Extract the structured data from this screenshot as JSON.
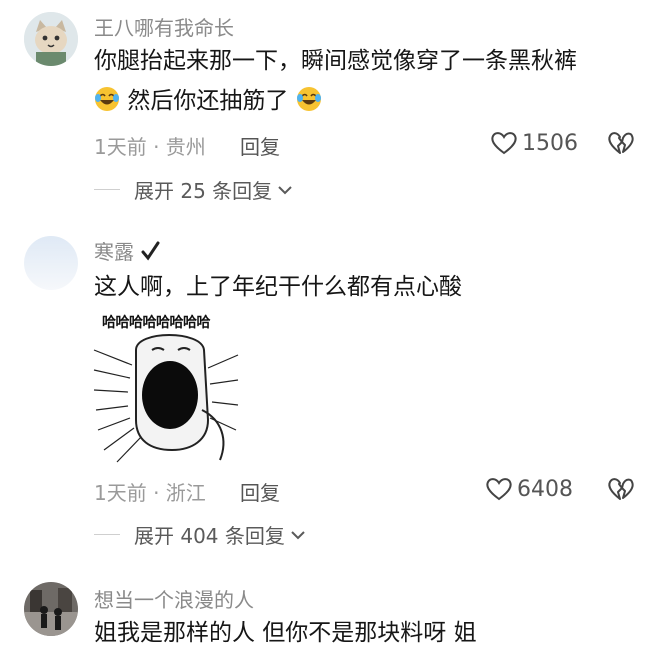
{
  "comments": [
    {
      "username": "王八哪有我命长",
      "text_line1": "你腿抬起来那一下，瞬间感觉像穿了一条黑秋裤",
      "text_line2": "然后你还抽筋了",
      "emoji": "laughing-crying-emoji",
      "meta": "1天前 · 贵州",
      "reply_label": "回复",
      "likes": "1506",
      "expand_label": "展开 25 条回复"
    },
    {
      "username": "寒露",
      "text": "这人啊，上了年纪干什么都有点心酸",
      "sticker_caption": "哈哈哈哈哈哈哈哈",
      "meta": "1天前 · 浙江",
      "reply_label": "回复",
      "likes": "6408",
      "expand_label": "展开 404 条回复"
    },
    {
      "username": "想当一个浪漫的人",
      "text": "姐我是那样的人 但你不是那块料呀 姐"
    }
  ],
  "colors": {
    "accent": "#161616",
    "muted": "#9a9a9a",
    "secondary": "#555555"
  },
  "icons": [
    "heart-icon",
    "broken-heart-icon",
    "chevron-down-icon",
    "check-icon",
    "laughing-crying-emoji"
  ]
}
